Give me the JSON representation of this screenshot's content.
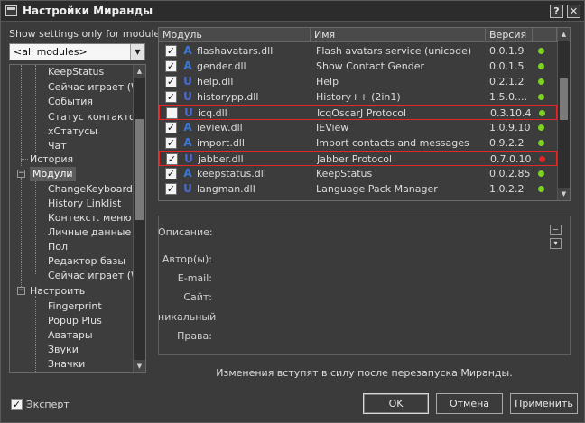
{
  "window": {
    "title": "Настройки Миранды",
    "help_label": "?",
    "close_label": "✕"
  },
  "left": {
    "module_label": "Show settings only for module:",
    "module_select": "<all modules>",
    "tree": [
      "KeepStatus",
      "Сейчас играет (WA",
      "События",
      "Статус контактов",
      "xСтатусы",
      "Чат",
      "История",
      "Модули",
      "ChangeKeyboardLa",
      "History Linklist",
      "Контекст. меню",
      "Личные данные",
      "Пол",
      "Редактор базы",
      "Сейчас играет (WA",
      "Настроить",
      "Fingerprint",
      "Popup Plus",
      "Аватары",
      "Звуки",
      "Значки"
    ],
    "expert_label": "Эксперт",
    "expert_checked": true
  },
  "table": {
    "headers": [
      "Модуль",
      "Имя",
      "Версия"
    ],
    "rows": [
      {
        "file": "flashavatars.dll",
        "name": "Flash avatars service (unicode)",
        "version": "0.0.1.9",
        "checked": true,
        "icon": "A",
        "status": "green",
        "highlight": false
      },
      {
        "file": "gender.dll",
        "name": "Show Contact Gender",
        "version": "0.0.1.5",
        "checked": true,
        "icon": "A",
        "status": "green",
        "highlight": false
      },
      {
        "file": "help.dll",
        "name": "Help",
        "version": "0.2.1.2",
        "checked": true,
        "icon": "U",
        "status": "green",
        "highlight": false
      },
      {
        "file": "historypp.dll",
        "name": "History++ (2in1)",
        "version": "1.5.0....",
        "checked": true,
        "icon": "U",
        "status": "green",
        "highlight": false
      },
      {
        "file": "icq.dll",
        "name": "IcqOscarJ Protocol",
        "version": "0.3.10.4",
        "checked": false,
        "icon": "U",
        "status": "green",
        "highlight": true
      },
      {
        "file": "ieview.dll",
        "name": "IEView",
        "version": "1.0.9.10",
        "checked": true,
        "icon": "A",
        "status": "green",
        "highlight": false
      },
      {
        "file": "import.dll",
        "name": "Import contacts and messages",
        "version": "0.9.2.2",
        "checked": true,
        "icon": "A",
        "status": "green",
        "highlight": false
      },
      {
        "file": "jabber.dll",
        "name": "Jabber Protocol",
        "version": "0.7.0.10",
        "checked": true,
        "icon": "U",
        "status": "red",
        "highlight": true
      },
      {
        "file": "keepstatus.dll",
        "name": "KeepStatus",
        "version": "0.0.2.85",
        "checked": true,
        "icon": "A",
        "status": "green",
        "highlight": false
      },
      {
        "file": "langman.dll",
        "name": "Language Pack Manager",
        "version": "1.0.2.2",
        "checked": true,
        "icon": "U",
        "status": "green",
        "highlight": false
      }
    ]
  },
  "description": {
    "labels": [
      "Описание:",
      "Автор(ы):",
      "E-mail:",
      "Сайт:",
      "никальный",
      "Права:"
    ]
  },
  "notice": "Изменения вступят в силу после перезапуска Миранды.",
  "buttons": {
    "ok": "OK",
    "cancel": "Отмена",
    "apply": "Применить"
  },
  "colors": {
    "status_green": "#7ed321",
    "status_red": "#e0282a",
    "icon_ansi": "#3a78d8",
    "icon_unicode": "#4a6ad8",
    "highlight_border": "#e0282a"
  }
}
